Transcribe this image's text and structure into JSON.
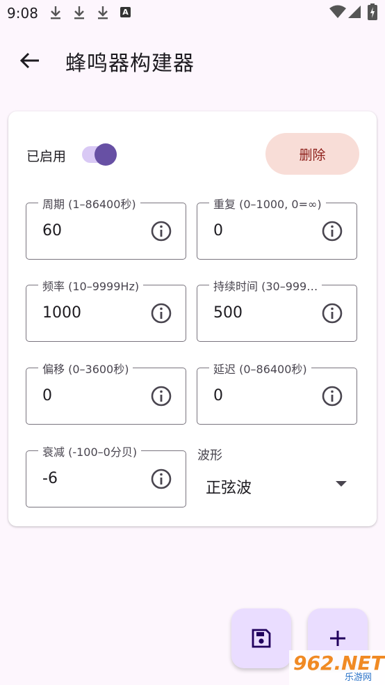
{
  "status_bar": {
    "time": "9:08",
    "notification_letter": "A"
  },
  "app_bar": {
    "title": "蜂鸣器构建器"
  },
  "card": {
    "enabled_label": "已启用",
    "enabled": true,
    "delete_label": "删除",
    "fields": {
      "period": {
        "label": "周期 (1–86400秒)",
        "value": "60"
      },
      "repeat": {
        "label": "重复 (0–1000, 0=∞)",
        "value": "0"
      },
      "frequency": {
        "label": "频率 (10–9999Hz)",
        "value": "1000"
      },
      "duration": {
        "label": "持续时间 (30–999…",
        "value": "500"
      },
      "offset": {
        "label": "偏移 (0–3600秒)",
        "value": "0"
      },
      "delay": {
        "label": "延迟 (0–86400秒)",
        "value": "0"
      },
      "decay": {
        "label": "衰减 (-100–0分贝)",
        "value": "-6"
      }
    },
    "waveform": {
      "label": "波形",
      "value": "正弦波"
    }
  },
  "colors": {
    "accent": "#6750a4",
    "fab_bg": "#eaddff",
    "delete_bg": "#f8ddd7",
    "delete_text": "#8c1d18"
  },
  "watermark": {
    "text": "962.NET",
    "sub": "乐游网"
  }
}
